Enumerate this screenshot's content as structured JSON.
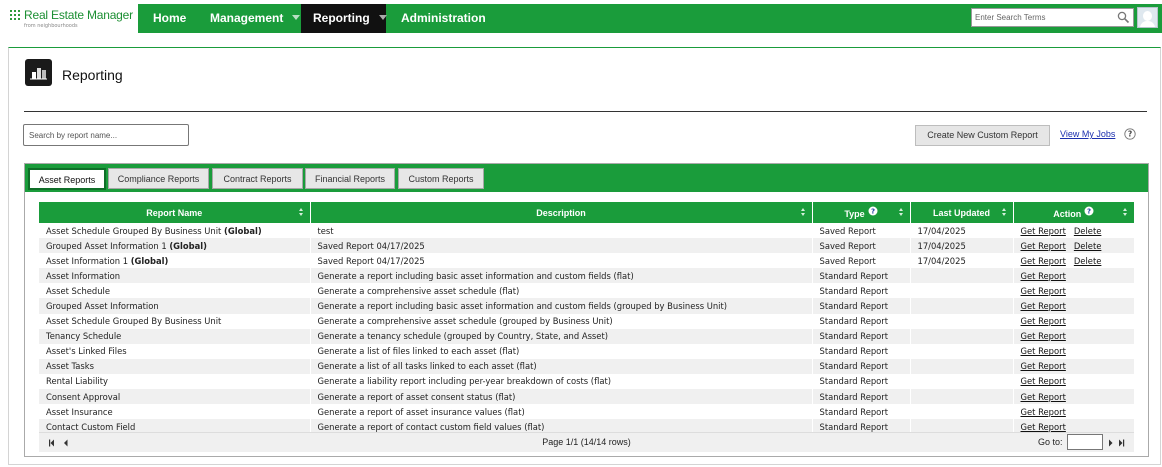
{
  "app": {
    "name": "Real Estate Manager",
    "tagline": "from neighbourhoods"
  },
  "nav": {
    "items": [
      {
        "label": "Home"
      },
      {
        "label": "Management"
      },
      {
        "label": "Reporting"
      },
      {
        "label": "Administration"
      }
    ],
    "active": "Reporting",
    "search_placeholder": "Enter Search Terms"
  },
  "page": {
    "title": "Reporting",
    "report_search_placeholder": "Search by report name...",
    "create_button": "Create New Custom Report",
    "jobs_link": "View My Jobs"
  },
  "tabs": [
    {
      "label": "Asset Reports"
    },
    {
      "label": "Compliance Reports"
    },
    {
      "label": "Contract Reports"
    },
    {
      "label": "Financial Reports"
    },
    {
      "label": "Custom Reports"
    }
  ],
  "active_tab": "Asset Reports",
  "table": {
    "columns": [
      "Report Name",
      "Description",
      "Type",
      "Last Updated",
      "Action"
    ],
    "rows": [
      {
        "name": "Asset Schedule Grouped By Business Unit",
        "global": "(Global)",
        "description": "test",
        "type": "Saved Report",
        "updated": "17/04/2025",
        "actions": [
          "Get Report",
          "Delete"
        ]
      },
      {
        "name": "Grouped Asset Information 1",
        "global": "(Global)",
        "description": "Saved Report 04/17/2025",
        "type": "Saved Report",
        "updated": "17/04/2025",
        "actions": [
          "Get Report",
          "Delete"
        ]
      },
      {
        "name": "Asset Information 1",
        "global": "(Global)",
        "description": "Saved Report 04/17/2025",
        "type": "Saved Report",
        "updated": "17/04/2025",
        "actions": [
          "Get Report",
          "Delete"
        ]
      },
      {
        "name": "Asset Information",
        "global": "",
        "description": "Generate a report including basic asset information and custom fields (flat)",
        "type": "Standard Report",
        "updated": "",
        "actions": [
          "Get Report"
        ]
      },
      {
        "name": "Asset Schedule",
        "global": "",
        "description": "Generate a comprehensive asset schedule (flat)",
        "type": "Standard Report",
        "updated": "",
        "actions": [
          "Get Report"
        ]
      },
      {
        "name": "Grouped Asset Information",
        "global": "",
        "description": "Generate a report including basic asset information and custom fields (grouped by Business Unit)",
        "type": "Standard Report",
        "updated": "",
        "actions": [
          "Get Report"
        ]
      },
      {
        "name": "Asset Schedule Grouped By Business Unit",
        "global": "",
        "description": "Generate a comprehensive asset schedule (grouped by Business Unit)",
        "type": "Standard Report",
        "updated": "",
        "actions": [
          "Get Report"
        ]
      },
      {
        "name": "Tenancy Schedule",
        "global": "",
        "description": "Generate a tenancy schedule (grouped by Country, State, and Asset)",
        "type": "Standard Report",
        "updated": "",
        "actions": [
          "Get Report"
        ]
      },
      {
        "name": "Asset's Linked Files",
        "global": "",
        "description": "Generate a list of files linked to each asset (flat)",
        "type": "Standard Report",
        "updated": "",
        "actions": [
          "Get Report"
        ]
      },
      {
        "name": "Asset Tasks",
        "global": "",
        "description": "Generate a list of all tasks linked to each asset (flat)",
        "type": "Standard Report",
        "updated": "",
        "actions": [
          "Get Report"
        ]
      },
      {
        "name": "Rental Liability",
        "global": "",
        "description": "Generate a liability report including per-year breakdown of costs (flat)",
        "type": "Standard Report",
        "updated": "",
        "actions": [
          "Get Report"
        ]
      },
      {
        "name": "Consent Approval",
        "global": "",
        "description": "Generate a report of asset consent status (flat)",
        "type": "Standard Report",
        "updated": "",
        "actions": [
          "Get Report"
        ]
      },
      {
        "name": "Asset Insurance",
        "global": "",
        "description": "Generate a report of asset insurance values (flat)",
        "type": "Standard Report",
        "updated": "",
        "actions": [
          "Get Report"
        ]
      },
      {
        "name": "Contact Custom Field",
        "global": "",
        "description": "Generate a report of contact custom field values (flat)",
        "type": "Standard Report",
        "updated": "",
        "actions": [
          "Get Report"
        ]
      }
    ]
  },
  "pager": {
    "info": "Page 1/1 (14/14 rows)",
    "goto_label": "Go to:",
    "goto_value": ""
  },
  "colors": {
    "brand_green": "#1a9c3b",
    "active_nav": "#111111",
    "link_blue": "#1b2fae"
  },
  "icons": [
    "search-icon",
    "user-avatar-icon",
    "reporting-icon",
    "help-icon",
    "sort-icon",
    "first-page-icon",
    "prev-page-icon",
    "next-page-icon",
    "last-page-icon"
  ]
}
